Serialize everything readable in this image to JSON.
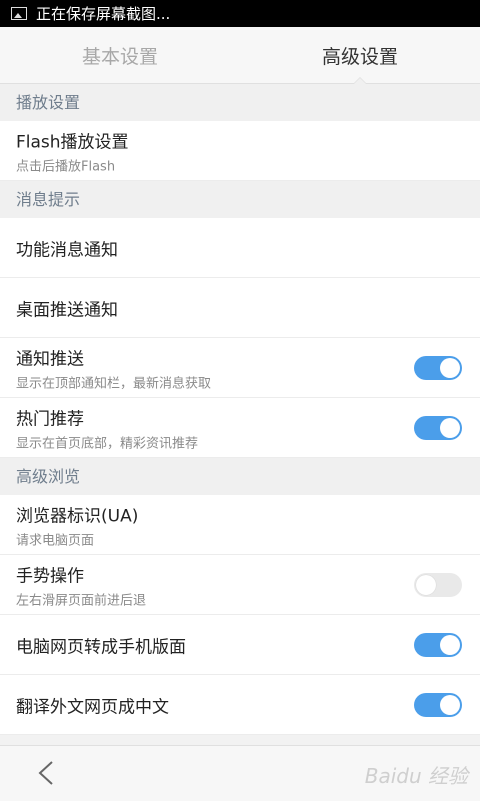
{
  "status_bar": {
    "text": "正在保存屏幕截图...",
    "icon": "image-icon"
  },
  "tabs": [
    {
      "label": "基本设置"
    },
    {
      "label": "高级设置"
    }
  ],
  "sections": [
    {
      "title": "播放设置",
      "rows": [
        {
          "title": "Flash播放设置",
          "subtitle": "点击后播放Flash"
        }
      ]
    },
    {
      "title": "消息提示",
      "rows": [
        {
          "title": "功能消息通知"
        },
        {
          "title": "桌面推送通知"
        },
        {
          "title": "通知推送",
          "subtitle": "显示在顶部通知栏，最新消息获取",
          "toggle": true
        },
        {
          "title": "热门推荐",
          "subtitle": "显示在首页底部，精彩资讯推荐",
          "toggle": true
        }
      ]
    },
    {
      "title": "高级浏览",
      "rows": [
        {
          "title": "浏览器标识(UA)",
          "subtitle": "请求电脑页面"
        },
        {
          "title": "手势操作",
          "subtitle": "左右滑屏页面前进后退",
          "toggle": false
        },
        {
          "title": "电脑网页转成手机版面",
          "toggle": true
        },
        {
          "title": "翻译外文网页成中文",
          "toggle": true
        }
      ]
    }
  ],
  "bottom_bar": {
    "back_icon": "chevron-left-icon",
    "watermark": "Baidu 经验"
  },
  "colors": {
    "accent": "#4b9eea",
    "section_text": "#6f7d8c"
  }
}
